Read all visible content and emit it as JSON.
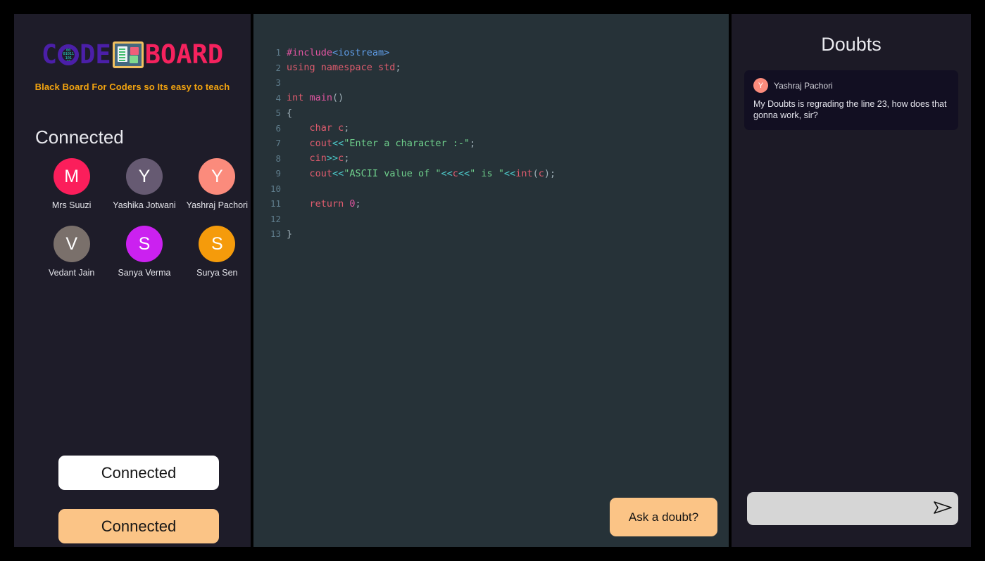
{
  "brand": {
    "logo_part1": "C",
    "logo_part2_bits": [
      "00",
      "01011",
      "101",
      "10"
    ],
    "logo_part3": "DE",
    "logo_part4": "BOARD",
    "board_icon": "board-icon",
    "tagline": "Black Board For Coders so Its easy to teach",
    "colors": {
      "code_purple": "#4b1fa8",
      "board_pink": "#f5225e",
      "tagline_orange": "#f2a30f",
      "accent_peach": "#fbc486"
    }
  },
  "sidebar": {
    "connected_heading": "Connected",
    "participants": [
      {
        "initial": "M",
        "name": "Mrs Suuzi",
        "color": "#fb1e5b"
      },
      {
        "initial": "Y",
        "name": "Yashika Jotwani",
        "color": "#665a72"
      },
      {
        "initial": "Y",
        "name": "Yashraj Pachori",
        "color": "#fb8b7c"
      },
      {
        "initial": "V",
        "name": "Vedant Jain",
        "color": "#7a706b"
      },
      {
        "initial": "S",
        "name": "Sanya Verma",
        "color": "#cb21f0"
      },
      {
        "initial": "S",
        "name": "Surya Sen",
        "color": "#f59b0b"
      }
    ],
    "buttons": {
      "connected_white": "Connected",
      "connected_orange": "Connected"
    }
  },
  "editor": {
    "language": "cpp",
    "lines": [
      {
        "n": "1",
        "tokens": [
          {
            "t": "#include",
            "c": "tk-pre"
          },
          {
            "t": "<iostream>",
            "c": "tk-inc"
          }
        ]
      },
      {
        "n": "2",
        "tokens": [
          {
            "t": "using namespace std",
            "c": "tk-kw"
          },
          {
            "t": ";",
            "c": "tk-punct"
          }
        ]
      },
      {
        "n": "3",
        "tokens": []
      },
      {
        "n": "4",
        "tokens": [
          {
            "t": "int ",
            "c": "tk-kw"
          },
          {
            "t": "main",
            "c": "tk-fn"
          },
          {
            "t": "()",
            "c": "tk-punct"
          }
        ]
      },
      {
        "n": "5",
        "tokens": [
          {
            "t": "{",
            "c": "tk-punct"
          }
        ]
      },
      {
        "n": "6",
        "tokens": [
          {
            "t": "    char ",
            "c": "tk-kw"
          },
          {
            "t": "c",
            "c": "tk-kw"
          },
          {
            "t": ";",
            "c": "tk-punct"
          }
        ]
      },
      {
        "n": "7",
        "tokens": [
          {
            "t": "    cout",
            "c": "tk-kw"
          },
          {
            "t": "<<",
            "c": "tk-op"
          },
          {
            "t": "\"Enter a character :-\"",
            "c": "tk-str"
          },
          {
            "t": ";",
            "c": "tk-punct"
          }
        ]
      },
      {
        "n": "8",
        "tokens": [
          {
            "t": "    cin",
            "c": "tk-kw"
          },
          {
            "t": ">>",
            "c": "tk-op"
          },
          {
            "t": "c",
            "c": "tk-kw"
          },
          {
            "t": ";",
            "c": "tk-punct"
          }
        ]
      },
      {
        "n": "9",
        "tokens": [
          {
            "t": "    cout",
            "c": "tk-kw"
          },
          {
            "t": "<<",
            "c": "tk-op"
          },
          {
            "t": "\"ASCII value of \"",
            "c": "tk-str"
          },
          {
            "t": "<<",
            "c": "tk-op"
          },
          {
            "t": "c",
            "c": "tk-kw"
          },
          {
            "t": "<<",
            "c": "tk-op"
          },
          {
            "t": "\" is \"",
            "c": "tk-str"
          },
          {
            "t": "<<",
            "c": "tk-op"
          },
          {
            "t": "int",
            "c": "tk-kw"
          },
          {
            "t": "(",
            "c": "tk-punct"
          },
          {
            "t": "c",
            "c": "tk-kw"
          },
          {
            "t": ")",
            "c": "tk-punct"
          },
          {
            "t": ";",
            "c": "tk-punct"
          }
        ]
      },
      {
        "n": "10",
        "tokens": []
      },
      {
        "n": "11",
        "tokens": [
          {
            "t": "    return ",
            "c": "tk-kw"
          },
          {
            "t": "0",
            "c": "tk-num"
          },
          {
            "t": ";",
            "c": "tk-punct"
          }
        ]
      },
      {
        "n": "12",
        "tokens": []
      },
      {
        "n": "13",
        "tokens": [
          {
            "t": "}",
            "c": "tk-punct"
          }
        ]
      }
    ],
    "ask_doubt_label": "Ask a doubt?"
  },
  "doubts": {
    "title": "Doubts",
    "messages": [
      {
        "avatar_initial": "Y",
        "avatar_color": "#fb8b7c",
        "author": "Yashraj Pachori",
        "text": "My Doubts is regrading the line 23, how does that gonna work, sir?"
      }
    ],
    "composer": {
      "value": "",
      "placeholder": "",
      "send_icon": "send-paper-plane-icon"
    }
  }
}
